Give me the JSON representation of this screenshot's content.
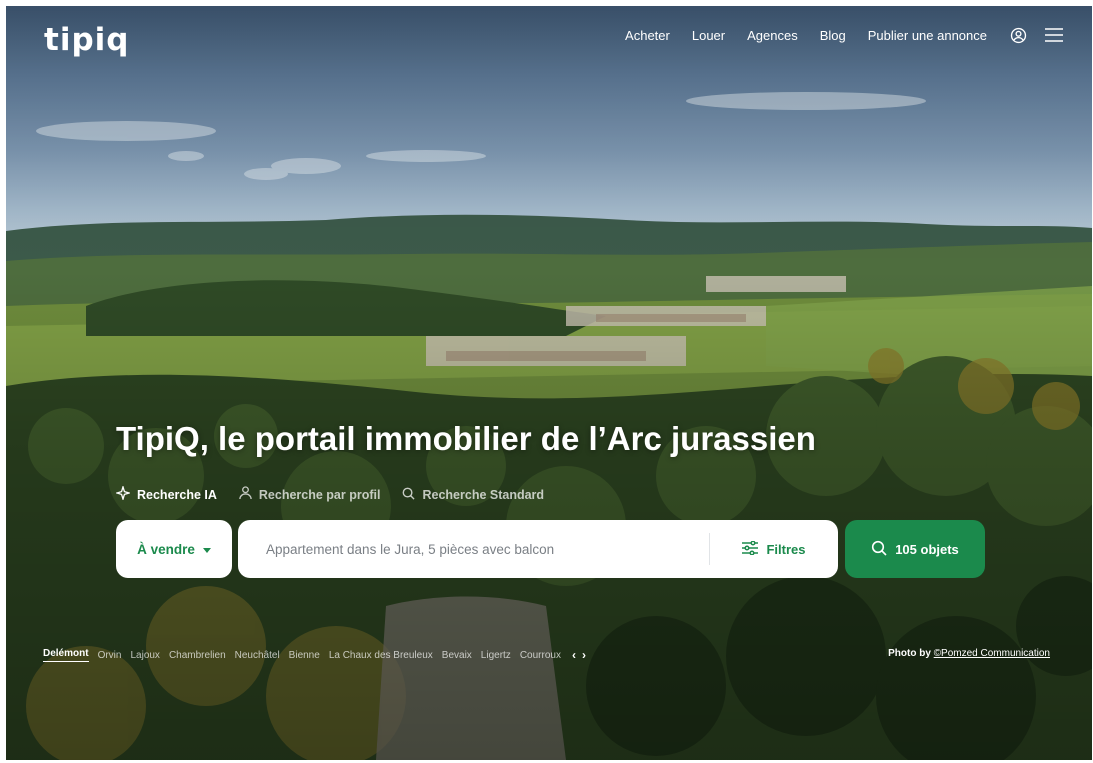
{
  "brand": {
    "logo": "tipiq"
  },
  "nav": {
    "items": [
      "Acheter",
      "Louer",
      "Agences",
      "Blog",
      "Publier une annonce"
    ],
    "icons": [
      "user-circle-icon",
      "menu-icon"
    ]
  },
  "hero": {
    "title": "TipiQ, le portail immobilier de l’Arc jurassien"
  },
  "search_tabs": [
    {
      "label": "Recherche IA",
      "icon": "sparkle-icon",
      "active": true
    },
    {
      "label": "Recherche par profil",
      "icon": "user-icon",
      "active": false
    },
    {
      "label": "Recherche Standard",
      "icon": "search-icon",
      "active": false
    }
  ],
  "search": {
    "mode_value": "À vendre",
    "placeholder": "Appartement dans le Jura, 5 pièces avec balcon",
    "filters_label": "Filtres",
    "results_label": "105 objets"
  },
  "locations": {
    "items": [
      "Delémont",
      "Orvin",
      "Lajoux",
      "Chambrelien",
      "Neuchâtel",
      "Bienne",
      "La Chaux des Breuleux",
      "Bevaix",
      "Ligertz",
      "Courroux"
    ],
    "active": "Delémont",
    "prev_symbol": "‹",
    "next_symbol": "›"
  },
  "credit": {
    "prefix": "Photo by",
    "author": "©Pomzed Communication"
  },
  "colors": {
    "accent": "#1b8a4c",
    "text_on_dark": "#ffffff"
  }
}
